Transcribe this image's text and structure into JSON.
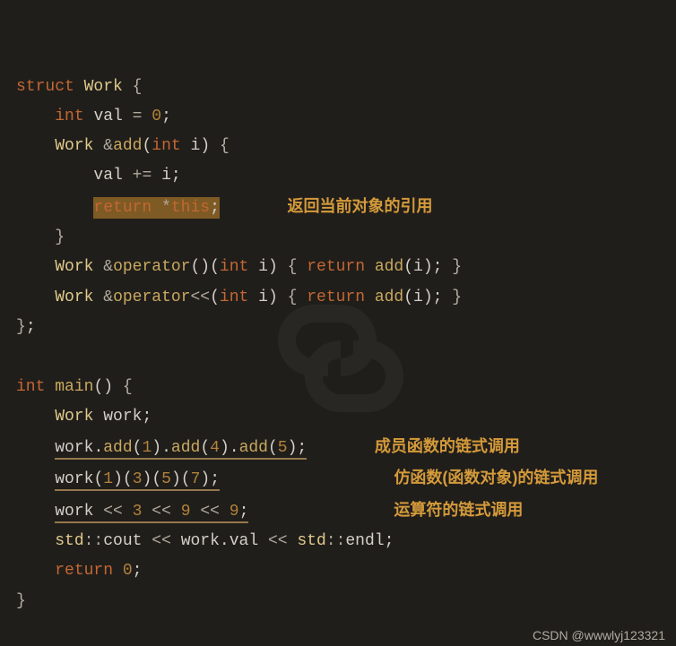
{
  "code": {
    "struct_kw": "struct",
    "work_type": "Work",
    "lb": "{",
    "rb": "}",
    "semicolon": ";",
    "int_kw": "int",
    "val_id": "val",
    "eq": "=",
    "zero": "0",
    "amp": "&",
    "add_fn": "add",
    "i_id": "i",
    "lp": "(",
    "rp": ")",
    "plus_eq": "+=",
    "return_kw": "return",
    "star": "*",
    "this_kw": "this",
    "operator_kw": "operator",
    "shl": "<<",
    "main_fn": "main",
    "work_decl": "work",
    "dot": ".",
    "comma": ",",
    "n1": "1",
    "n3": "3",
    "n4": "4",
    "n5": "5",
    "n7": "7",
    "n9": "9",
    "std": "std",
    "scope": "::",
    "cout": "cout",
    "endl": "endl",
    "val": "val"
  },
  "notes": {
    "return_ref": "返回当前对象的引用",
    "chain_member": "成员函数的链式调用",
    "chain_functor": "仿函数(函数对象)的链式调用",
    "chain_operator": "运算符的链式调用"
  },
  "watermark": "CSDN @wwwlyj123321"
}
